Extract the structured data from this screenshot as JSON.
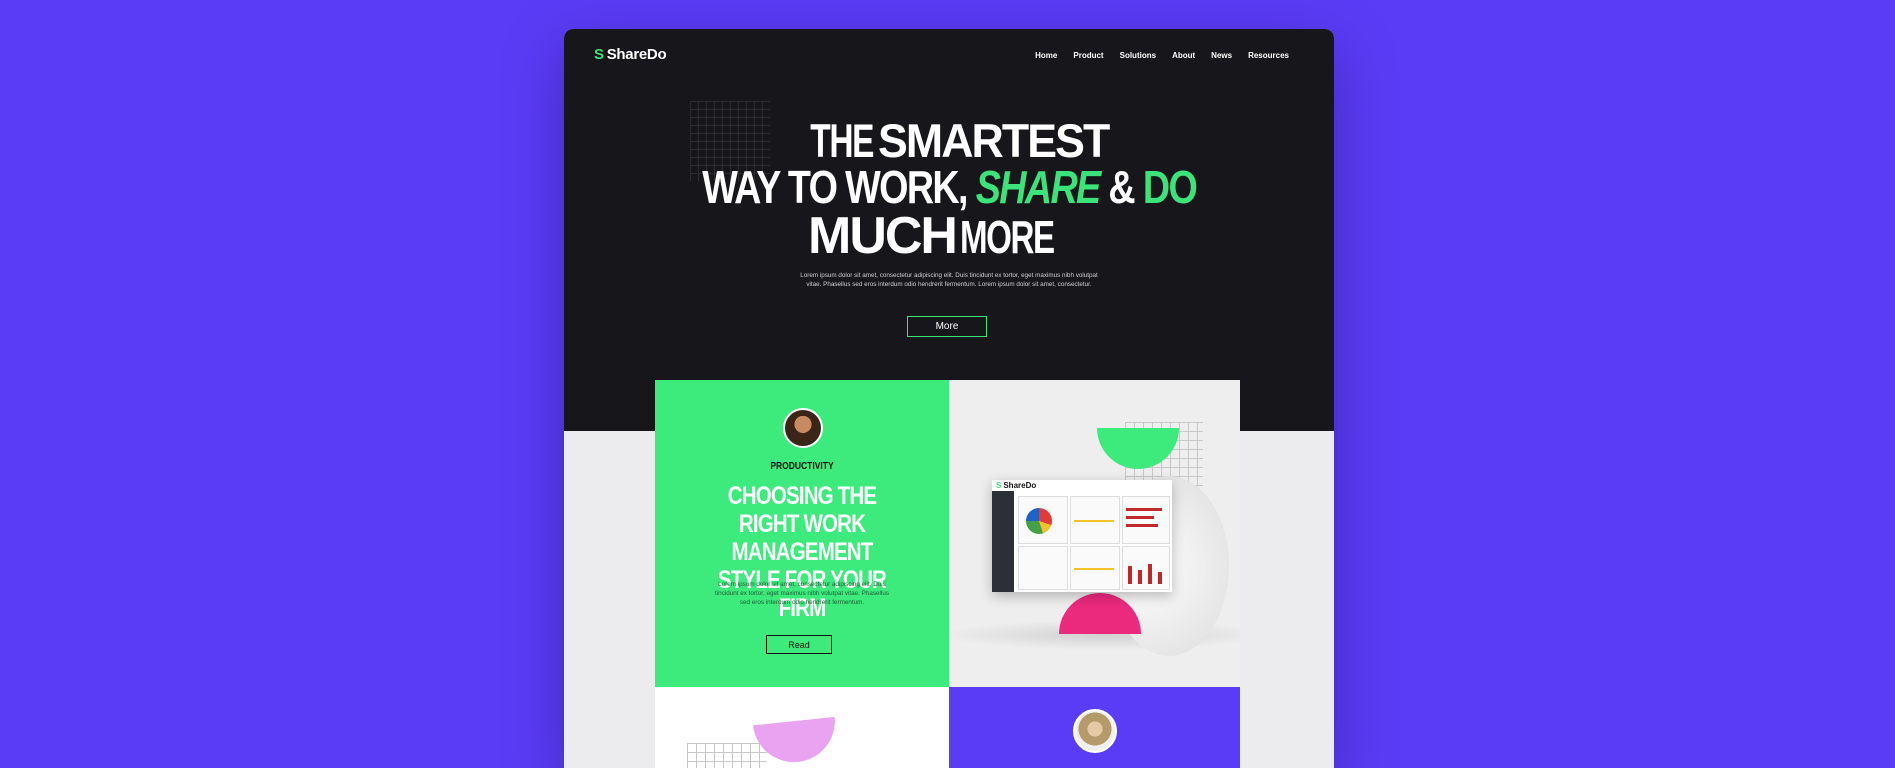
{
  "logo": {
    "mark": "S",
    "name": "ShareDo"
  },
  "nav": [
    "Home",
    "Product",
    "Solutions",
    "About",
    "News",
    "Resources"
  ],
  "hero": {
    "line1_a": "THE",
    "line1_b": "SMARTEST",
    "line2_a": "WAY TO WORK,",
    "line2_b": "SHARE",
    "line2_c": "&",
    "line2_d": "DO",
    "line3_a": "MUCH",
    "line3_b": "MORE",
    "body": "Lorem ipsum dolor sit amet, consectetur adipiscing elit. Duis tincidunt ex tortor, eget maximus nibh volutpat vitae. Phasellus sed eros interdum odio hendrerit fermentum. Lorem ipsum dolor sit amet, consectetur.",
    "button": "More"
  },
  "card1": {
    "kicker": "PRODUCTIVITY",
    "title": "CHOOSING THE RIGHT WORK MANAGEMENT STYLE FOR YOUR FIRM",
    "body": "Lorem ipsum dolor sit amet, consectetur adipiscing elit. Duis tincidunt ex tortor, eget maximus nibh volutpat vitae. Phasellus sed eros interdum odio hendrerit fermentum.",
    "button": "Read"
  },
  "dashboard": {
    "logo": "ShareDo"
  },
  "colors": {
    "brand_green": "#3ceb7c",
    "purple": "#5b3cf6",
    "dark": "#17171b",
    "pink": "#ec2a7d"
  }
}
